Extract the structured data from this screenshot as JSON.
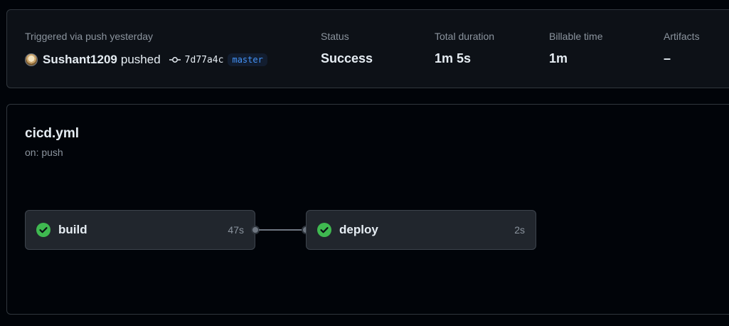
{
  "summary": {
    "trigger_label": "Triggered via push yesterday",
    "actor": "Sushant1209",
    "action": "pushed",
    "commit_sha": "7d77a4c",
    "branch": "master",
    "status_label": "Status",
    "status_value": "Success",
    "duration_label": "Total duration",
    "duration_value": "1m 5s",
    "billable_label": "Billable time",
    "billable_value": "1m",
    "artifacts_label": "Artifacts",
    "artifacts_value": "–"
  },
  "workflow": {
    "file": "cicd.yml",
    "trigger": "on: push",
    "jobs": [
      {
        "name": "build",
        "duration": "47s",
        "status": "success"
      },
      {
        "name": "deploy",
        "duration": "2s",
        "status": "success"
      }
    ]
  },
  "colors": {
    "success": "#3fb950",
    "accent_blue": "#4493f8"
  },
  "icons": {
    "commit": "git-commit-icon",
    "check": "check-circle-icon"
  }
}
